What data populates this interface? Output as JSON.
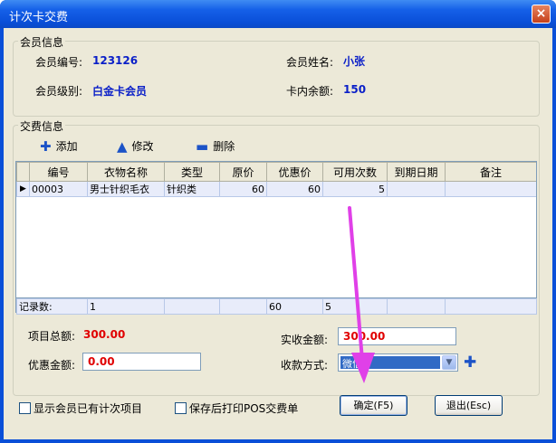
{
  "window": {
    "title": "计次卡交费",
    "close_glyph": "×"
  },
  "member_group": {
    "legend": "会员信息",
    "member_no_label": "会员编号:",
    "member_no": "123126",
    "member_name_label": "会员姓名:",
    "member_name": "小张",
    "member_level_label": "会员级别:",
    "member_level": "白金卡会员",
    "balance_label": "卡内余额:",
    "balance": "150"
  },
  "fee_group": {
    "legend": "交费信息",
    "toolbar": {
      "add": "添加",
      "edit": "修改",
      "delete": "删除"
    },
    "columns": [
      "编号",
      "衣物名称",
      "类型",
      "原价",
      "优惠价",
      "可用次数",
      "到期日期",
      "备注"
    ],
    "rows": [
      {
        "indicator": "▶",
        "no": "00003",
        "name": "男士针织毛衣",
        "type": "针织类",
        "price": "60",
        "discount_price": "60",
        "count": "5",
        "expiry": "",
        "note": ""
      }
    ],
    "footer": {
      "label": "记录数:",
      "records": "1",
      "discount_total": "60",
      "count_total": "5"
    }
  },
  "totals": {
    "item_total_label": "项目总额:",
    "item_total": "300.00",
    "received_label": "实收金额:",
    "received": "300.00",
    "discount_label": "优惠金额:",
    "discount": "0.00",
    "payment_label": "收款方式:",
    "payment_method": "微信"
  },
  "options": {
    "show_existing": "显示会员已有计次项目",
    "print_after_save": "保存后打印POS交费单"
  },
  "buttons": {
    "confirm": "确定(F5)",
    "exit": "退出(Esc)"
  },
  "colors": {
    "titlebar": "#0a4fd8",
    "value_blue": "#0a1fc8",
    "value_red": "#e00000",
    "arrow": "#e040e8"
  }
}
